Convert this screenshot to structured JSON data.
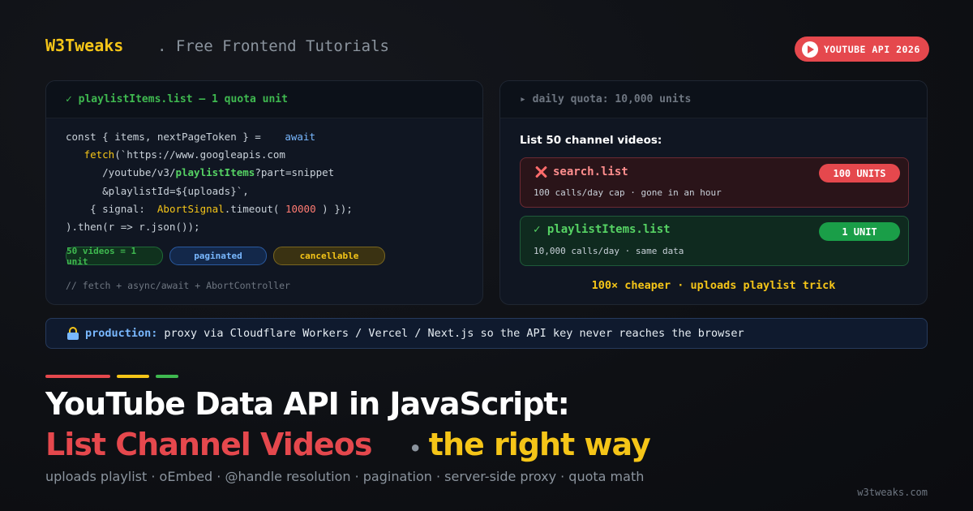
{
  "header": {
    "brand": "W3Tweaks",
    "tagline": ". Free Frontend Tutorials",
    "badge": "YOUTUBE API 2026",
    "badge_icon": "youtube-play-icon"
  },
  "left_panel": {
    "title": "✓ playlistItems.list — 1 quota unit",
    "code": {
      "l1a": "const { items, nextPageToken } = ",
      "l1b": "await",
      "l2a": "fetch",
      "l2b": "(`https://www.googleapis.com",
      "l3a": "/youtube/v3/",
      "l3b": "playlistItems",
      "l3c": "?part=snippet",
      "l4": "&playlistId=${uploads}`,",
      "l5a": "{ signal: ",
      "l5b": "AbortSignal",
      "l5c": ".timeout(",
      "l5d": "10000",
      "l5e": ") });",
      "l6": ").then(r => r.json());"
    },
    "chips": [
      "50 videos = 1 unit",
      "paginated",
      "cancellable"
    ],
    "comment": "// fetch + async/await + AbortController"
  },
  "right_panel": {
    "title": "▸ daily quota: 10,000 units",
    "list_title": "List 50 channel videos:",
    "bad": {
      "name": "search.list",
      "badge": "100 UNITS",
      "sub": "100 calls/day cap · gone in an hour"
    },
    "good": {
      "name": "✓ playlistItems.list",
      "badge": "1 UNIT",
      "sub": "10,000 calls/day · same data"
    },
    "footer": "100× cheaper · uploads playlist trick"
  },
  "production": {
    "label": "production:",
    "text": "proxy via Cloudflare Workers / Vercel / Next.js so the API key never reaches the browser"
  },
  "title": {
    "line1": "YouTube Data API in JavaScript:",
    "line2_red": "List Channel Videos",
    "line2_dot": "•",
    "line2_yellow": "the right way"
  },
  "subtitle": "uploads playlist · oEmbed · @handle resolution · pagination · server-side proxy · quota math",
  "site": "w3tweaks.com",
  "colors": {
    "accent_red": "#e5484d",
    "accent_yellow": "#f5c518",
    "accent_green": "#3fb950",
    "accent_blue": "#79b8ff"
  }
}
